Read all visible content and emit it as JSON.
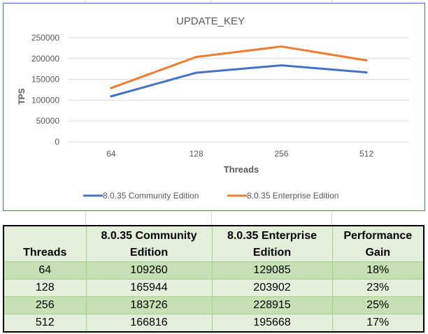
{
  "chart_data": {
    "type": "line",
    "title": "UPDATE_KEY",
    "xlabel": "Threads",
    "ylabel": "TPS",
    "categories": [
      "64",
      "128",
      "256",
      "512"
    ],
    "ylim": [
      0,
      250000
    ],
    "yticks": [
      "0",
      "50000",
      "100000",
      "150000",
      "200000",
      "250000"
    ],
    "grid": true,
    "legend_position": "bottom",
    "series": [
      {
        "name": "8.0.35 Community Edition",
        "color": "#4472c4",
        "values": [
          109260,
          165944,
          183726,
          166816
        ]
      },
      {
        "name": "8.0.35 Enterprise Edition",
        "color": "#ed7d31",
        "values": [
          129085,
          203902,
          228915,
          195668
        ]
      }
    ]
  },
  "table": {
    "headers": [
      {
        "line1": "",
        "line2": "Threads"
      },
      {
        "line1": "8.0.35 Community",
        "line2": "Edition"
      },
      {
        "line1": "8.0.35 Enterprise",
        "line2": "Edition"
      },
      {
        "line1": "Performance",
        "line2": "Gain"
      }
    ],
    "rows": [
      [
        "64",
        "109260",
        "129085",
        "18%"
      ],
      [
        "128",
        "165944",
        "203902",
        "23%"
      ],
      [
        "256",
        "183726",
        "228915",
        "25%"
      ],
      [
        "512",
        "166816",
        "195668",
        "17%"
      ]
    ]
  }
}
